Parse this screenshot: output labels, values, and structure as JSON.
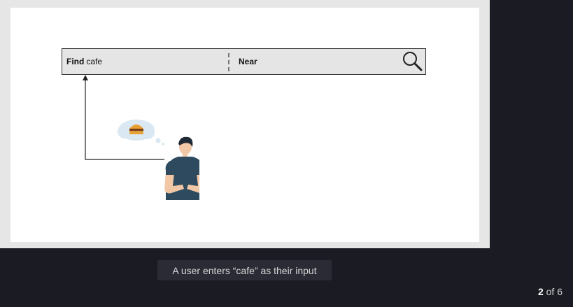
{
  "search_bar": {
    "find_label": "Find",
    "find_value": "cafe",
    "near_label": "Near"
  },
  "icons": {
    "search": "search-icon",
    "thought": "burger-thought-bubble-icon",
    "user": "user-illustration"
  },
  "caption": "A user enters “cafe” as their input",
  "pager": {
    "current": "2",
    "separator": "of",
    "total": "6"
  },
  "colors": {
    "background": "#1b1b24",
    "slide_frame": "#e6e6e6",
    "search_bar": "#e5e5e5",
    "caption_bg": "#2a2b35"
  }
}
